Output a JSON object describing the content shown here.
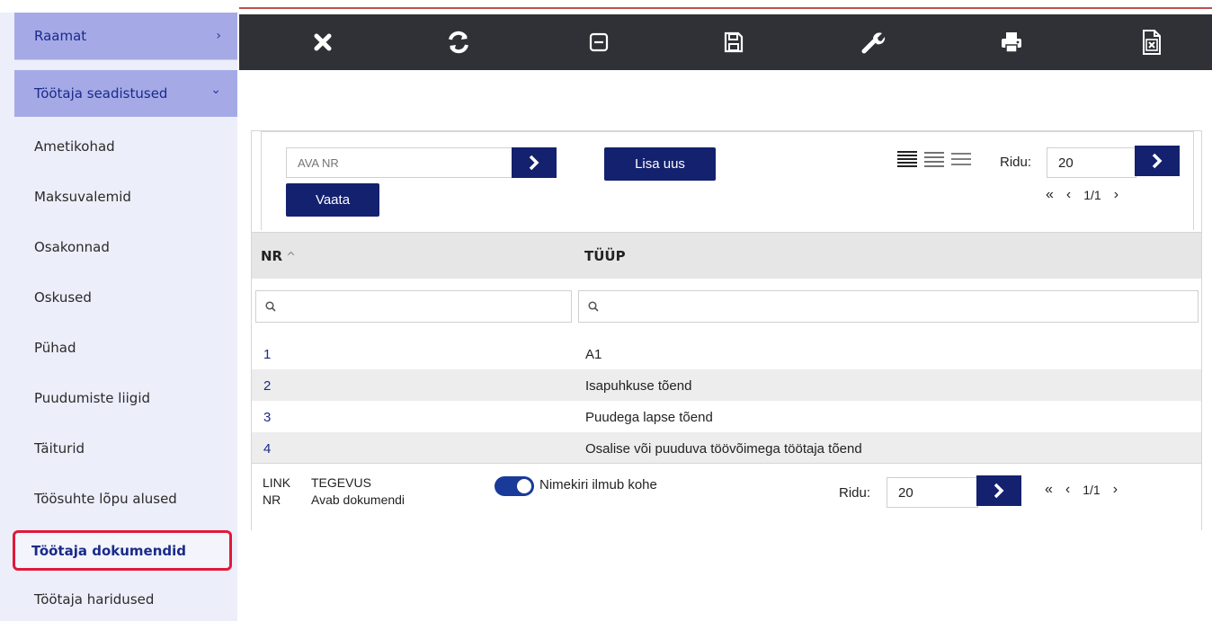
{
  "sidebar": {
    "groups": [
      {
        "label": "Raamat",
        "chevron": "›"
      },
      {
        "label": "Töötaja seadistused",
        "chevron": "⌄"
      }
    ],
    "items": [
      {
        "label": "Ametikohad"
      },
      {
        "label": "Maksuvalemid"
      },
      {
        "label": "Osakonnad"
      },
      {
        "label": "Oskused"
      },
      {
        "label": "Pühad"
      },
      {
        "label": "Puudumiste liigid"
      },
      {
        "label": "Täiturid"
      },
      {
        "label": "Töösuhte lõpu alused"
      },
      {
        "label": "Töötaja dokumendid",
        "active": true
      },
      {
        "label": "Töötaja haridused"
      }
    ]
  },
  "toolbar": {
    "icons": [
      "close-icon",
      "refresh-icon",
      "collapse-icon",
      "save-icon",
      "wrench-icon",
      "print-icon",
      "excel-icon"
    ]
  },
  "controls": {
    "ava_placeholder": "AVA NR",
    "lisa_label": "Lisa uus",
    "vaata_label": "Vaata",
    "ridu_label": "Ridu:",
    "ridu_value": "20",
    "page_text": "1/1"
  },
  "table": {
    "columns": [
      "NR",
      "TÜÜP"
    ],
    "sort_indicator": "^",
    "rows": [
      {
        "nr": "1",
        "tyyp": "A1"
      },
      {
        "nr": "2",
        "tyyp": "Isapuhkuse tõend"
      },
      {
        "nr": "3",
        "tyyp": "Puudega lapse tõend"
      },
      {
        "nr": "4",
        "tyyp": "Osalise või puuduva töövõimega töötaja tõend"
      }
    ]
  },
  "footer": {
    "legend_header": [
      "LINK",
      "TEGEVUS"
    ],
    "legend_row": [
      "NR",
      "Avab dokumendi"
    ],
    "toggle_label": "Nimekiri ilmub kohe",
    "toggle_on": true,
    "ridu_label": "Ridu:",
    "ridu_value": "20",
    "page_text": "1/1"
  },
  "colors": {
    "accent": "#14216e",
    "toolbar_bg": "#2f3137",
    "sidebar_group": "#a5aae6",
    "active_outline": "#e01a3a"
  }
}
